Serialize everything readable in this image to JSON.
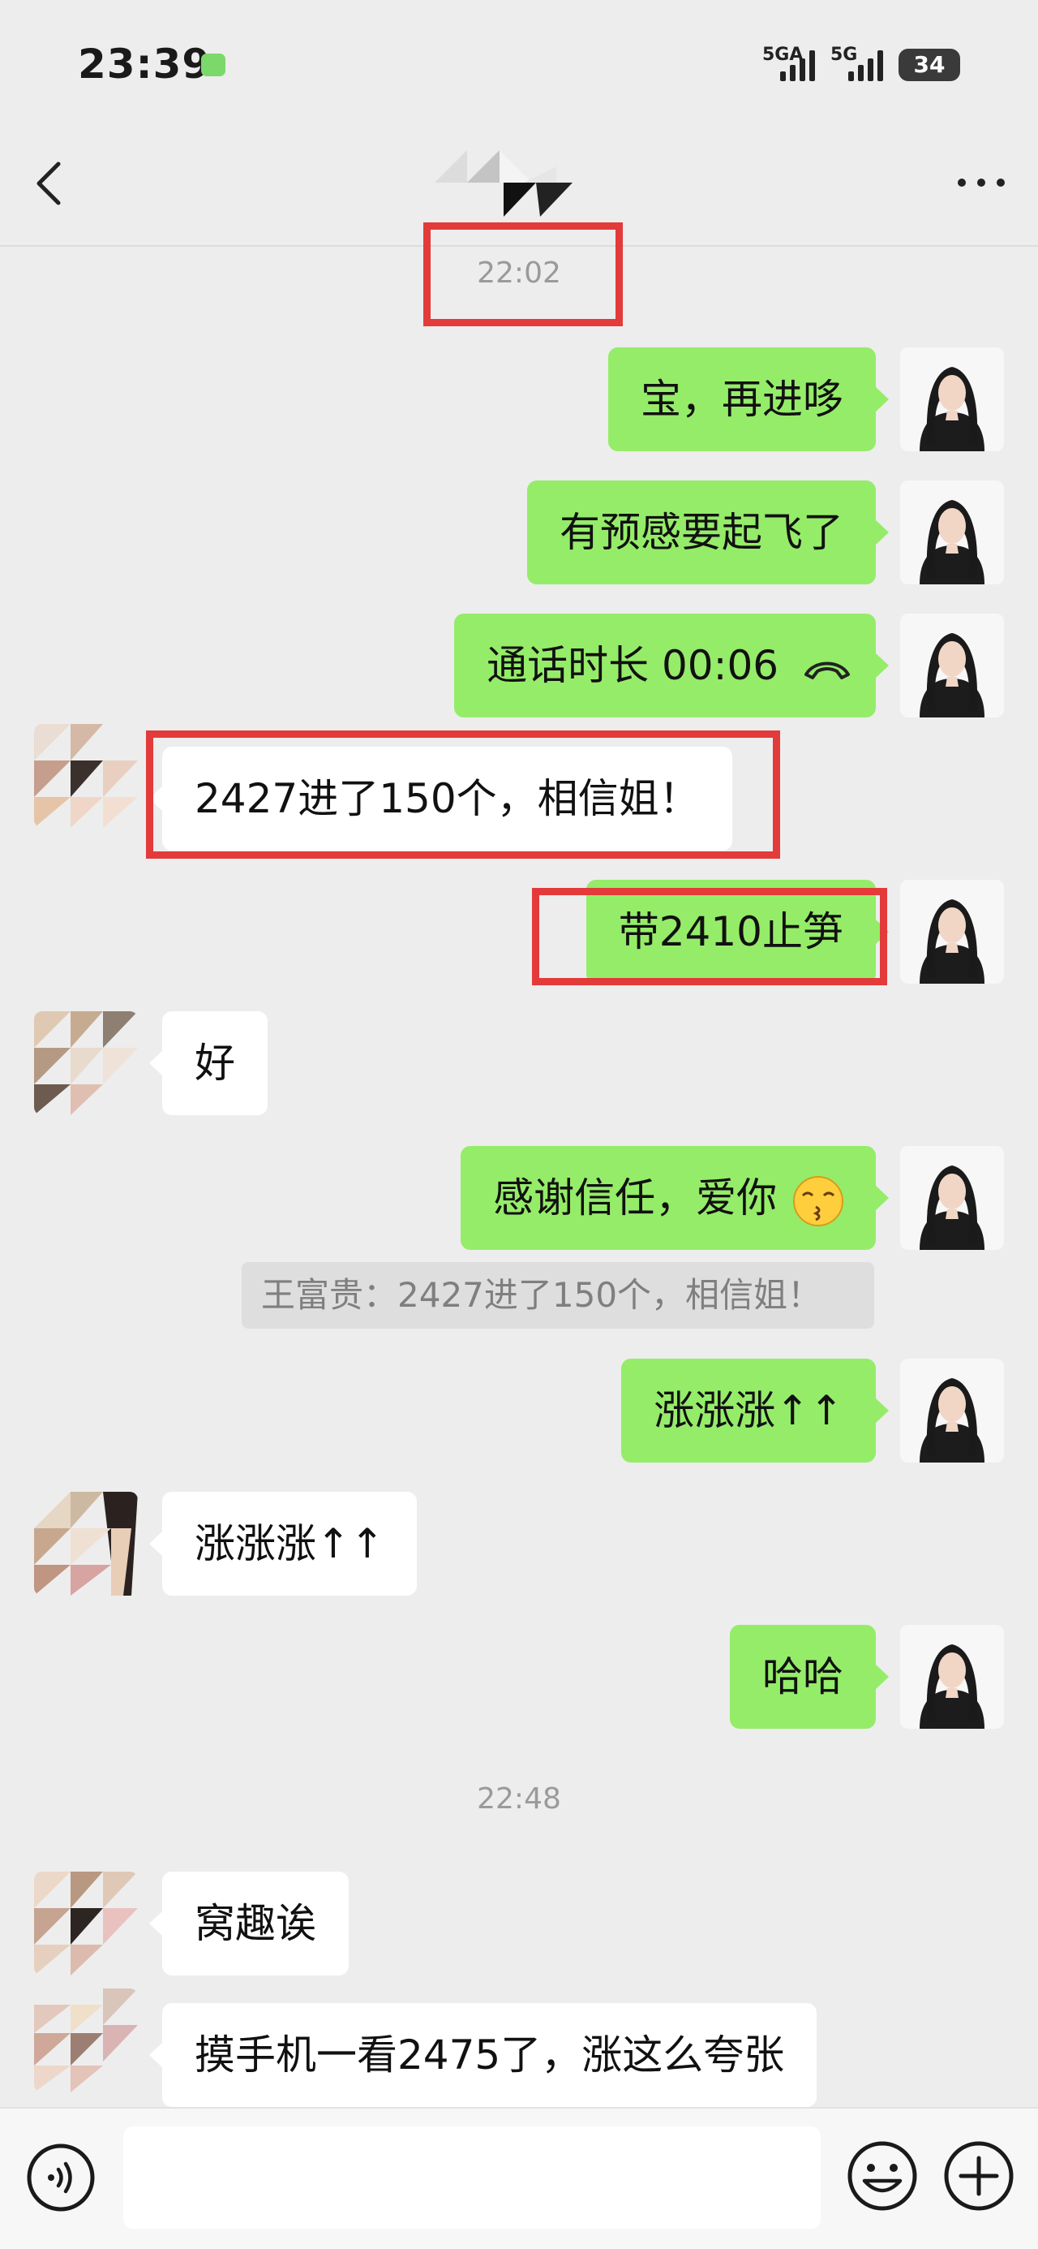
{
  "status_bar": {
    "time": "23:39",
    "network1": "5GA",
    "network2": "5G",
    "battery": "34"
  },
  "header": {
    "back": "back-arrow-icon",
    "more": "more-dots-icon"
  },
  "timestamps": [
    "22:02",
    "22:48"
  ],
  "messages": [
    {
      "from": "me",
      "text": "宝，再进哆"
    },
    {
      "from": "me",
      "text": "有预感要起飞了"
    },
    {
      "from": "me",
      "text": "通话时长  00:06",
      "icon": "phone-hangup-icon"
    },
    {
      "from": "them",
      "text": "2427进了150个，相信姐！"
    },
    {
      "from": "me",
      "text": "带2410止笋"
    },
    {
      "from": "them",
      "text": "好"
    },
    {
      "from": "me",
      "text": "感谢信任，爱你",
      "icon": "kiss-emoji-icon"
    },
    {
      "from": "me",
      "text": "涨涨涨↑↑"
    },
    {
      "from": "them",
      "text": "涨涨涨↑↑"
    },
    {
      "from": "me",
      "text": "哈哈"
    },
    {
      "from": "them",
      "text": "窝趣诶"
    },
    {
      "from": "them",
      "text": "摸手机一看2475了，涨这么夸张"
    }
  ],
  "quote": "王富贵：2427进了150个，相信姐！",
  "colors": {
    "background": "#ededed",
    "my_bubble": "#95ec69",
    "their_bubble": "#ffffff",
    "highlight_box": "#e33a3a"
  }
}
